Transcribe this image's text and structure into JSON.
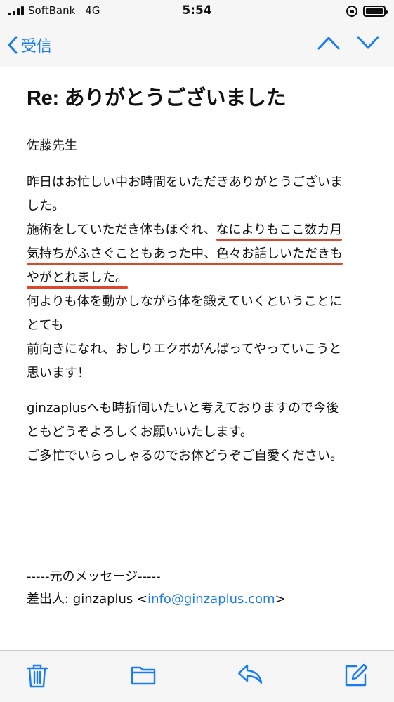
{
  "status_bar": {
    "carrier": "SoftBank",
    "network": "4G",
    "time": "5:54"
  },
  "nav": {
    "back_label": "受信"
  },
  "email": {
    "subject": "Re: ありがとうございました",
    "greeting": "佐藤先生",
    "lines": [
      "昨日はお忙しい中お時間をいただきありがとうございま",
      "した。"
    ],
    "line3_plain": "施術をしていただき体もほぐれ、",
    "line3_highlight": "なによりもここ数カ月",
    "line4_highlight": "気持ちがふさぐこともあった中、色々お話しいただきも",
    "line5_highlight": "やがとれました。",
    "more_lines": [
      "何よりも体を動かしながら体を鍛えていくということに",
      "とても",
      "前向きになれ、おしりエクボがんばってやっていこうと",
      "思います！"
    ],
    "closing_lines": [
      "ginzaplusへも時折伺いたいと考えておりますので今後",
      "ともどうぞよろしくお願いいたします。",
      "ご多忙でいらっしゃるのでお体どうぞご自愛ください。"
    ],
    "original_header": "-----元のメッセージ-----",
    "from_prefix": "差出人: ginzaplus <",
    "from_email": "info@ginzaplus.com",
    "from_suffix": ">"
  },
  "toolbar": {
    "icons": [
      "trash-icon",
      "folder-icon",
      "reply-icon",
      "compose-icon"
    ]
  },
  "colors": {
    "accent": "#1a7cf5",
    "highlight_underline": "#e0462b"
  }
}
